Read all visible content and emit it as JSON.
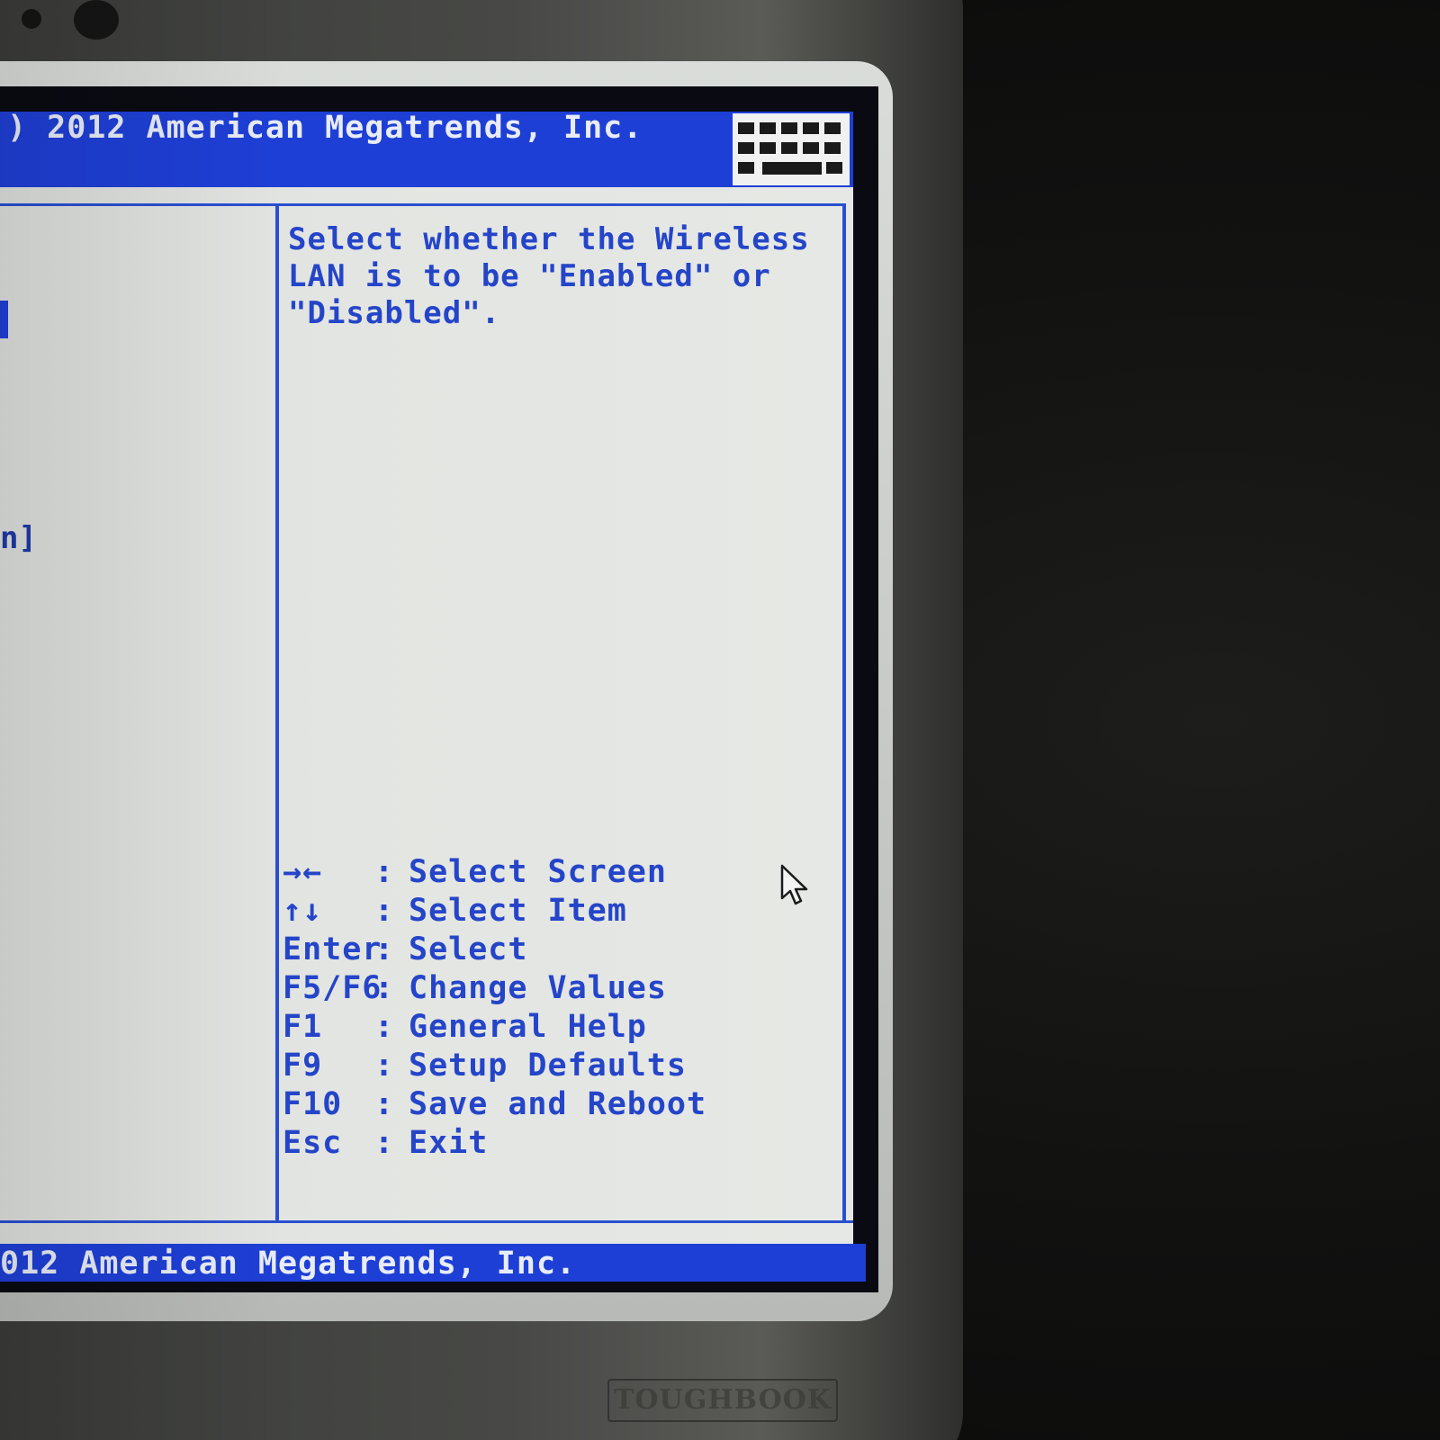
{
  "header": {
    "copyright": ") 2012 American Megatrends, Inc."
  },
  "footer": {
    "copyright": "012 American Megatrends, Inc."
  },
  "left_panel": {
    "fragment": "n]"
  },
  "help": {
    "lines": [
      "Select whether the Wireless",
      "LAN is to be \"Enabled\" or",
      "\"Disabled\"."
    ]
  },
  "keys": [
    {
      "key": "→←",
      "sep": ":",
      "desc": "Select Screen"
    },
    {
      "key": "↑↓",
      "sep": ":",
      "desc": "Select Item"
    },
    {
      "key": "Enter",
      "sep": ":",
      "desc": "Select"
    },
    {
      "key": "F5/F6",
      "sep": ":",
      "desc": "Change Values"
    },
    {
      "key": "F1",
      "sep": ":",
      "desc": "General Help"
    },
    {
      "key": "F9",
      "sep": ":",
      "desc": "Setup Defaults"
    },
    {
      "key": "F10",
      "sep": ":",
      "desc": "Save and Reboot"
    },
    {
      "key": "Esc",
      "sep": ":",
      "desc": "Exit"
    }
  ],
  "device": {
    "brand": "TOUGHBOOK"
  },
  "icons": {
    "keyboard": "keyboard-icon",
    "cursor": "mouse-pointer-icon"
  },
  "colors": {
    "bar_blue": "#1e3fd6",
    "text_blue": "#2545c9",
    "panel_bg": "#e3e5e2"
  }
}
